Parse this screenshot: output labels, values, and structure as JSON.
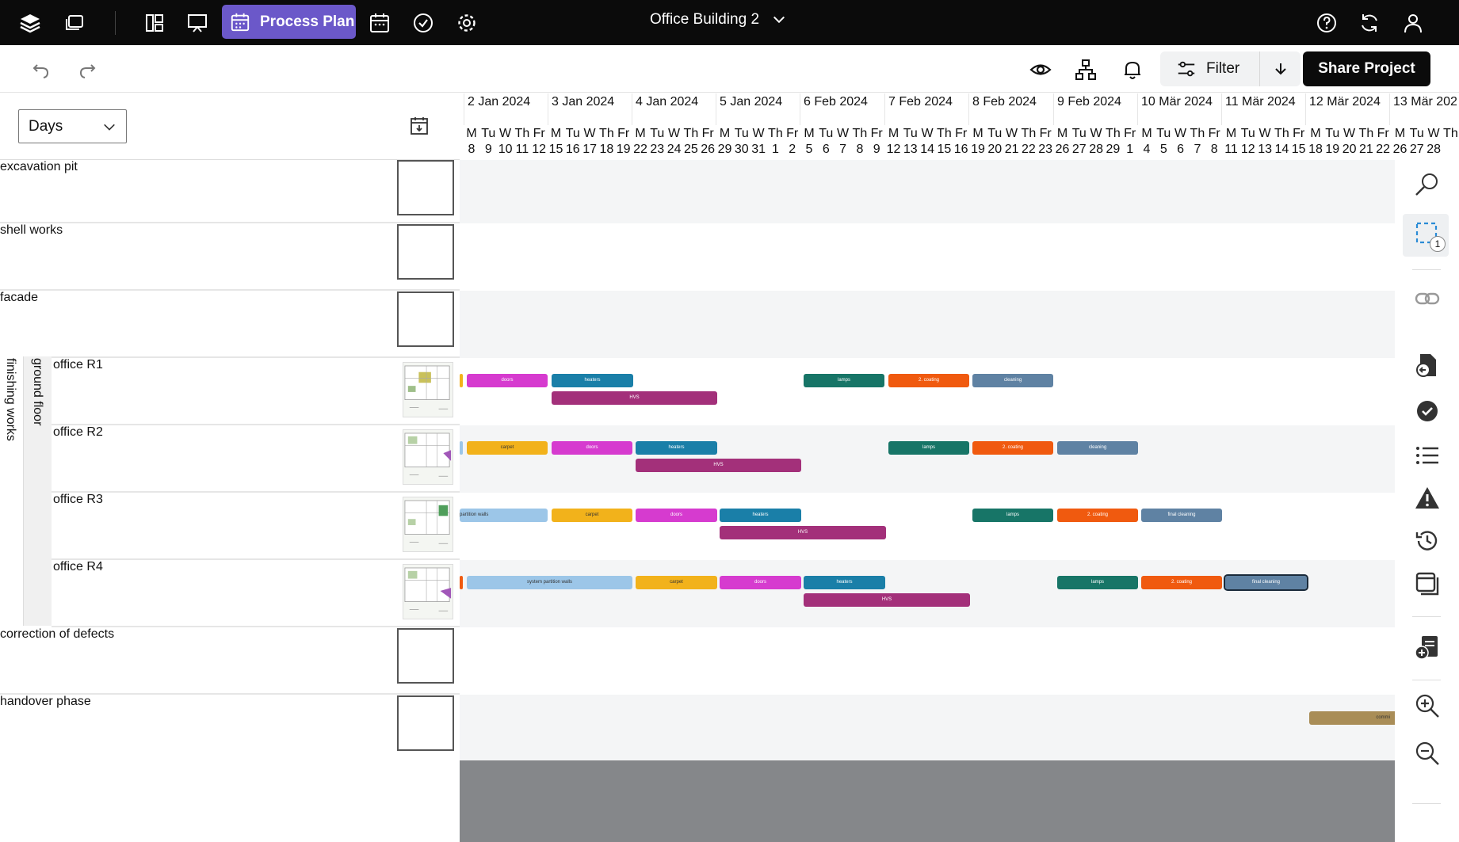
{
  "app": {
    "process_plan_label": "Process Plan",
    "project_title": "Office Building 2"
  },
  "toolbar": {
    "filter_label": "Filter",
    "share_label": "Share Project"
  },
  "scale_select": {
    "value": "Days"
  },
  "timeline": {
    "dates": [
      "2 Jan 2024",
      "3 Jan 2024",
      "4 Jan 2024",
      "5 Jan 2024",
      "6 Feb 2024",
      "7 Feb 2024",
      "8 Feb 2024",
      "9 Feb 2024",
      "10 Mär 2024",
      "11 Mär 2024",
      "12 Mär 2024",
      "13 Mär 202"
    ],
    "first_date_partial": "",
    "dow": [
      "M",
      "Tu",
      "W",
      "Th",
      "Fr",
      "M",
      "Tu",
      "W",
      "Th",
      "Fr",
      "M",
      "Tu",
      "W",
      "Th",
      "Fr",
      "M",
      "Tu",
      "W",
      "Th",
      "Fr",
      "M",
      "Tu",
      "W",
      "Th",
      "Fr",
      "M",
      "Tu",
      "W",
      "Th",
      "Fr",
      "M",
      "Tu",
      "W",
      "Th",
      "Fr",
      "M",
      "Tu",
      "W",
      "Th",
      "Fr",
      "M",
      "Tu",
      "W",
      "Th",
      "Fr",
      "M",
      "Tu",
      "W",
      "Th",
      "Fr",
      "M",
      "Tu",
      "W",
      "Th",
      "Fr",
      "M",
      "Tu",
      "W",
      "Th"
    ],
    "dnum": [
      "8",
      "9",
      "10",
      "11",
      "12",
      "15",
      "16",
      "17",
      "18",
      "19",
      "22",
      "23",
      "24",
      "25",
      "26",
      "29",
      "30",
      "31",
      "1",
      "2",
      "5",
      "6",
      "7",
      "8",
      "9",
      "12",
      "13",
      "14",
      "15",
      "16",
      "19",
      "20",
      "21",
      "22",
      "23",
      "26",
      "27",
      "28",
      "29",
      "1",
      "4",
      "5",
      "6",
      "7",
      "8",
      "11",
      "12",
      "13",
      "14",
      "15",
      "18",
      "19",
      "20",
      "21",
      "22",
      "26",
      "27",
      "28"
    ]
  },
  "rows": [
    {
      "label": "excavation pit"
    },
    {
      "label": "shell works"
    },
    {
      "label": "facade"
    },
    {
      "label": "office R1"
    },
    {
      "label": "office R2"
    },
    {
      "label": "office R3"
    },
    {
      "label": "office R4"
    },
    {
      "label": "correction of defects"
    },
    {
      "label": "handover phase"
    }
  ],
  "groups": {
    "outer": "finishing works",
    "inner": "ground floor"
  },
  "colors": {
    "doors": "#d63bcf",
    "heaters": "#1a7fa8",
    "hvs": "#a3307a",
    "lamps": "#177567",
    "coating": "#f05a0f",
    "cleaning": "#5f82a3",
    "carpet": "#f2b21b",
    "partition": "#9cc6e8",
    "commissioning": "#a98d57"
  },
  "bars": {
    "r1": [
      "doors",
      "heaters",
      "HVS",
      "lamps",
      "2. coating",
      "cleaning"
    ],
    "r2": [
      "carpet",
      "doors",
      "heaters",
      "HVS",
      "lamps",
      "2. coating",
      "cleaning"
    ],
    "r3": [
      "partition walls",
      "carpet",
      "doors",
      "heaters",
      "HVS",
      "lamps",
      "2. coating",
      "final cleaning"
    ],
    "r4": [
      "system partition walls",
      "carpet",
      "doors",
      "heaters",
      "HVS",
      "lamps",
      "2. coating",
      "final cleaning"
    ],
    "handover": [
      "commi"
    ]
  },
  "rightbar": {
    "selection_count": "1"
  }
}
